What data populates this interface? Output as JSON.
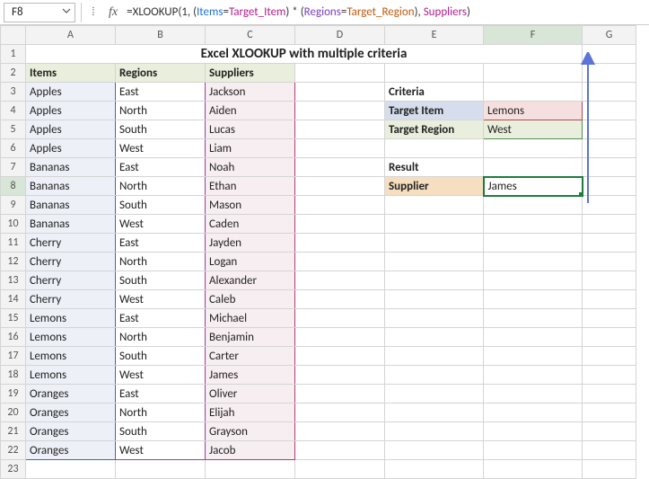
{
  "namebox": "F8",
  "formula": {
    "prefix": "=XLOOKUP(1, (",
    "arg1": "Items",
    "eq1": "=",
    "arg2": "Target_Item",
    "mid1": ") * (",
    "arg3": "Regions",
    "eq2": "=",
    "arg4": "Target_Region",
    "mid2": "), ",
    "arg5": "Suppliers",
    "suffix": ")"
  },
  "columns": [
    "A",
    "B",
    "C",
    "D",
    "E",
    "F",
    "G"
  ],
  "title": "Excel XLOOKUP with multiple criteria",
  "headers": {
    "items": "Items",
    "regions": "Regions",
    "suppliers": "Suppliers"
  },
  "side": {
    "criteria": "Criteria",
    "targetItemLabel": "Target Item",
    "targetItemValue": "Lemons",
    "targetRegionLabel": "Target Region",
    "targetRegionValue": "West",
    "result": "Result",
    "supplierLabel": "Supplier",
    "supplierValue": "James"
  },
  "chart_data": {
    "type": "table",
    "columns": [
      "Items",
      "Regions",
      "Suppliers"
    ],
    "rows": [
      [
        "Apples",
        "East",
        "Jackson"
      ],
      [
        "Apples",
        "North",
        "Aiden"
      ],
      [
        "Apples",
        "South",
        "Lucas"
      ],
      [
        "Apples",
        "West",
        "Liam"
      ],
      [
        "Bananas",
        "East",
        "Noah"
      ],
      [
        "Bananas",
        "North",
        "Ethan"
      ],
      [
        "Bananas",
        "South",
        "Mason"
      ],
      [
        "Bananas",
        "West",
        "Caden"
      ],
      [
        "Cherry",
        "East",
        "Jayden"
      ],
      [
        "Cherry",
        "North",
        "Logan"
      ],
      [
        "Cherry",
        "South",
        "Alexander"
      ],
      [
        "Cherry",
        "West",
        "Caleb"
      ],
      [
        "Lemons",
        "East",
        "Michael"
      ],
      [
        "Lemons",
        "North",
        "Benjamin"
      ],
      [
        "Lemons",
        "South",
        "Carter"
      ],
      [
        "Lemons",
        "West",
        "James"
      ],
      [
        "Oranges",
        "East",
        "Oliver"
      ],
      [
        "Oranges",
        "North",
        "Elijah"
      ],
      [
        "Oranges",
        "South",
        "Grayson"
      ],
      [
        "Oranges",
        "West",
        "Jacob"
      ]
    ]
  }
}
